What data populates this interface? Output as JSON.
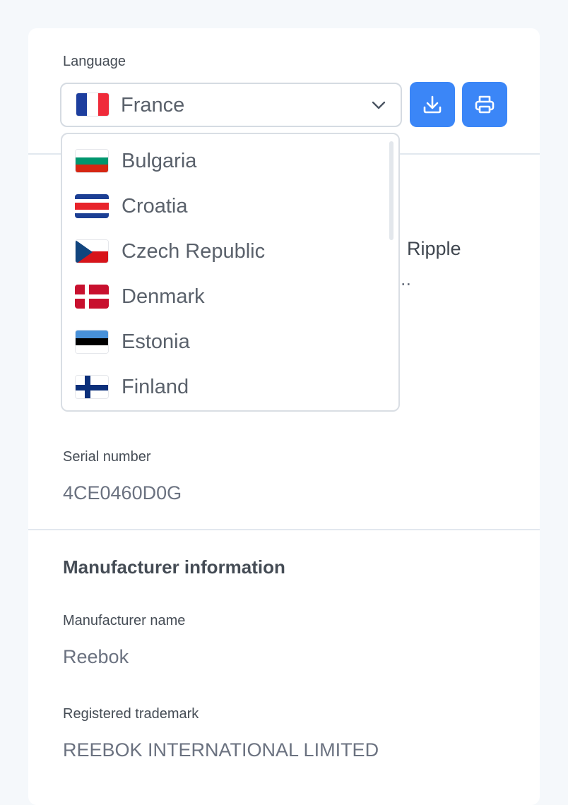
{
  "language": {
    "label": "Language",
    "selected": "France",
    "options": [
      "Bulgaria",
      "Croatia",
      "Czech Republic",
      "Denmark",
      "Estonia",
      "Finland"
    ]
  },
  "buttons": {
    "download_icon": "download-icon",
    "print_icon": "print-icon",
    "accent_color": "#3b86f7"
  },
  "partially_hidden": {
    "text_fragment": "Ripple",
    "ellipsis_fragment": ".."
  },
  "serial": {
    "label": "Serial number",
    "value": "4CE0460D0G"
  },
  "manufacturer": {
    "title": "Manufacturer information",
    "name_label": "Manufacturer name",
    "name_value": "Reebok",
    "trademark_label": "Registered trademark",
    "trademark_value": "REEBOK INTERNATIONAL LIMITED"
  }
}
